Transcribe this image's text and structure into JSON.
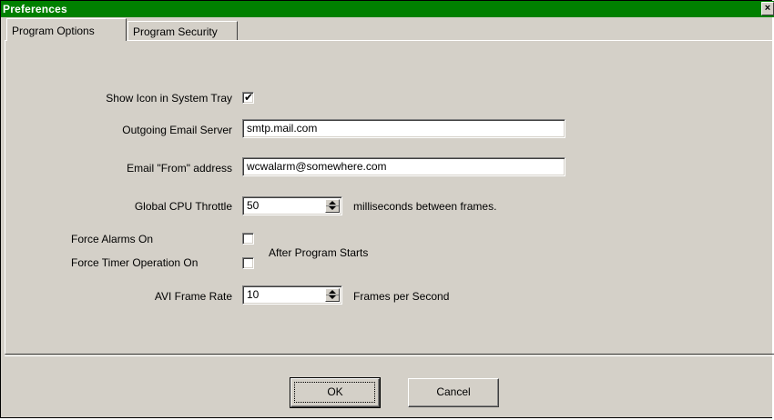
{
  "window": {
    "title": "Preferences",
    "close_glyph": "×"
  },
  "tabs": [
    {
      "label": "Program Options",
      "active": true
    },
    {
      "label": "Program Security",
      "active": false
    }
  ],
  "fields": {
    "show_icon": {
      "label": "Show Icon in System Tray",
      "checked": true,
      "mark": "✔"
    },
    "email_server": {
      "label": "Outgoing Email Server",
      "value": "smtp.mail.com"
    },
    "email_from": {
      "label": "Email \"From\" address",
      "value": "wcwalarm@somewhere.com"
    },
    "cpu_throttle": {
      "label": "Global CPU Throttle",
      "value": "50",
      "suffix": "milliseconds between frames."
    },
    "force_alarms": {
      "label": "Force Alarms On",
      "checked": false
    },
    "force_timer": {
      "label": "Force Timer Operation On",
      "checked": false
    },
    "after_start": {
      "label": "After Program Starts"
    },
    "avi_rate": {
      "label": "AVI Frame Rate",
      "value": "10",
      "suffix": "Frames per Second"
    }
  },
  "buttons": {
    "ok": "OK",
    "cancel": "Cancel"
  },
  "icons": {
    "close": "close-icon",
    "check": "checkmark-icon",
    "spin_up": "spin-up-icon",
    "spin_down": "spin-down-icon"
  },
  "colors": {
    "titlebar": "#008000",
    "face": "#d4d0c8"
  }
}
